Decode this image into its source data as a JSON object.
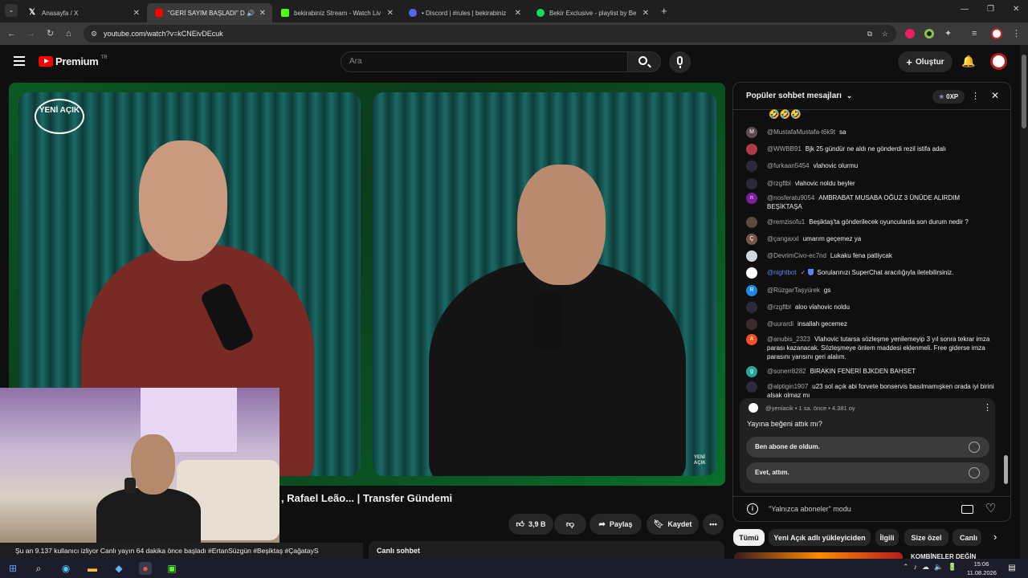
{
  "browser": {
    "tabs": [
      {
        "title": "Anasayfa / X",
        "icon": "x-logo-icon",
        "color": "#ffffff"
      },
      {
        "title": "\"GERİ SAYIM BAŞLADI\" Du",
        "icon": "youtube-logo-icon",
        "color": "#ff0000",
        "active": true
      },
      {
        "title": "bekirabiniz Stream - Watch Live",
        "icon": "kick-logo-icon",
        "color": "#53fc18"
      },
      {
        "title": "• Discord | #rules | bekirabiniz",
        "icon": "discord-logo-icon",
        "color": "#5865f2"
      },
      {
        "title": "Bekir Exclusive - playlist by Bek",
        "icon": "spotify-logo-icon",
        "color": "#1ed760"
      }
    ],
    "new_tab": "+",
    "url": "youtube.com/watch?v=kCNEivDEcuk"
  },
  "masthead": {
    "logo_text": "Premium",
    "logo_region": "TR",
    "search_placeholder": "Ara",
    "create_label": "Oluştur"
  },
  "video": {
    "watermark": "YENİ AÇIK",
    "small_watermark": "YENİ AÇIK",
    "title_visible": ", Rafael Leão... | Transfer Gündemi",
    "likes": "3,9 B",
    "share_label": "Paylaş",
    "save_label": "Kaydet",
    "info_text": "Şu an 9.137 kullanıcı izliyor  Canlı yayın 64 dakika önce başladı  #ErtanSüzgün #Beşiktaş #ÇağatayS",
    "live_chat_label": "Canlı sohbet"
  },
  "chat": {
    "header": "Popüler sohbet mesajları",
    "points": "0XP",
    "top_emojis": "🤣🤣🤣",
    "messages": [
      {
        "author": "@MustafaMustafa-t6k9t",
        "text": "sa",
        "avatar": "M",
        "color": "#5c4b51"
      },
      {
        "author": "@WWBB91",
        "text": "Bjk 25 gündür ne aldı ne gönderdi rezil istifa adalı",
        "avatar": "",
        "color": "#b23a48"
      },
      {
        "author": "@furkaan5454",
        "text": "vlahovic olurmu",
        "avatar": "",
        "color": "#2a2a3a"
      },
      {
        "author": "@rzgftbl",
        "text": "vlahovic noldu beyler",
        "avatar": "",
        "color": "#2a2a3a"
      },
      {
        "author": "@nosferatu9054",
        "text": "AMBRABAT MUSABA OĞUZ 3 ÜNÜDE ALIRDIM BEŞİKTAŞA",
        "avatar": "n",
        "color": "#7b1fa2"
      },
      {
        "author": "@remzisofu1",
        "text": "Beşiktaş'ta gönderilecek oyuncularda son durum nedir ?",
        "avatar": "",
        "color": "#5a4a3a"
      },
      {
        "author": "@çangaxxl",
        "text": "umarım geçemez ya",
        "avatar": "Ç",
        "color": "#795548"
      },
      {
        "author": "@DevrimCivo-ec7nd",
        "text": "Lukaku fena patliycak",
        "avatar": "",
        "color": "#cfd8dc"
      },
      {
        "author": "@nightbot",
        "text": "Sorularınızı SuperChat aracılığıyla iletebilirsiniz.",
        "avatar": "",
        "color": "#ffffff",
        "mod": true
      },
      {
        "author": "@RüzgarTaşyürek",
        "text": "gs",
        "avatar": "R",
        "color": "#1e88e5"
      },
      {
        "author": "@rzgftbl",
        "text": "aloo vlahovic noldu",
        "avatar": "",
        "color": "#2a2a3a"
      },
      {
        "author": "@uurardi",
        "text": "insallah gecemez",
        "avatar": "",
        "color": "#3a2a2a"
      },
      {
        "author": "@anubis_2323",
        "text": "Vlahovic tutarsa sözleşme yenilemeyip 3 yıl sonra tekrar imza parası kazanacak. Sözleşmeye önlem maddesi eklenmeli. Free giderse imza parasını yarısını geri alalım.",
        "avatar": "A",
        "color": "#f4511e"
      },
      {
        "author": "@sonerr8282",
        "text": "BIRAKIN FENERİ BJKDEN BAHSET",
        "avatar": "g",
        "color": "#26a69a"
      },
      {
        "author": "@alptigin1907",
        "text": "u23 sol açık abi forvete bonservis basılmamışken orada iyi birini alsak olmaz mı",
        "avatar": "",
        "color": "#2a2a3a"
      }
    ],
    "poll": {
      "meta": "@yeniacik • 1 sa. önce • 4.381 oy",
      "question": "Yayına beğeni attık mı?",
      "options": [
        "Ben abone de oldum.",
        "Evet, attım."
      ]
    },
    "footer_text": "\"Yalnızca aboneler\" modu"
  },
  "chips": [
    "Tümü",
    "Yeni Açık adlı yükleyiciden",
    "İlgili",
    "Size özel",
    "Canlı"
  ],
  "recommendation_peek": "KOMBİNELER DEĞİN",
  "taskbar": {
    "time": "15:06",
    "date": "11.08.2026"
  }
}
